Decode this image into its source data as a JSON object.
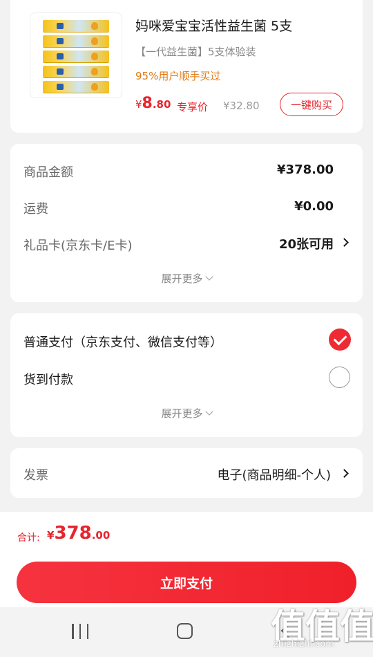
{
  "product": {
    "title": "妈咪爱宝宝活性益生菌 5支",
    "subtitle": "【一代益生菌】5支体验装",
    "note": "95%用户顺手买过",
    "price_currency": "¥",
    "price_int": "8",
    "price_dec": ".80",
    "price_tag": "专享价",
    "original_price": "¥32.80",
    "buy_label": "一键购买"
  },
  "summary": {
    "rows": [
      {
        "label": "商品金额",
        "value": "¥378.00"
      },
      {
        "label": "运费",
        "value": "¥0.00"
      },
      {
        "label": "礼品卡(京东卡/E卡)",
        "value": "20张可用"
      }
    ],
    "expand_label": "展开更多"
  },
  "payment": {
    "options": [
      {
        "label": "普通支付（京东支付、微信支付等）",
        "selected": true
      },
      {
        "label": "货到付款",
        "selected": false
      }
    ],
    "expand_label": "展开更多"
  },
  "invoice": {
    "label": "发票",
    "value": "电子(商品明细-个人)"
  },
  "footer": {
    "total_label": "合计:",
    "total_currency": "¥",
    "total_int": "378",
    "total_dec": ".00",
    "pay_label": "立即支付"
  },
  "watermark": {
    "glyphs": "值值值",
    "url": "zhizhizhi.com"
  },
  "colors": {
    "accent": "#e8242c",
    "note": "#e07a10"
  },
  "icons": [
    "chevron-right-icon",
    "chevron-down-icon",
    "check-circle-icon",
    "radio-empty-icon",
    "nav-recent-icon",
    "nav-home-icon",
    "nav-back-icon"
  ]
}
